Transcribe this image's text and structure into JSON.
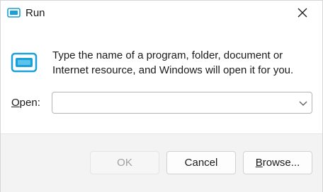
{
  "window": {
    "title": "Run",
    "close_icon": "close-icon"
  },
  "dialog": {
    "app_icon": "run-icon",
    "description": "Type the name of a program, folder, document or Internet resource, and Windows will open it for you.",
    "open_label_accesskey": "O",
    "open_label_rest": "pen:",
    "open_input_value": "",
    "open_dropdown_icon": "chevron-down-icon"
  },
  "buttons": {
    "ok_label": "OK",
    "cancel_label": "Cancel",
    "browse_accesskey": "B",
    "browse_rest": "rowse..."
  },
  "colors": {
    "accent": "#1aa0d8",
    "disabled_text": "#a0a0a0",
    "footer_bg": "#f3f3f3"
  }
}
